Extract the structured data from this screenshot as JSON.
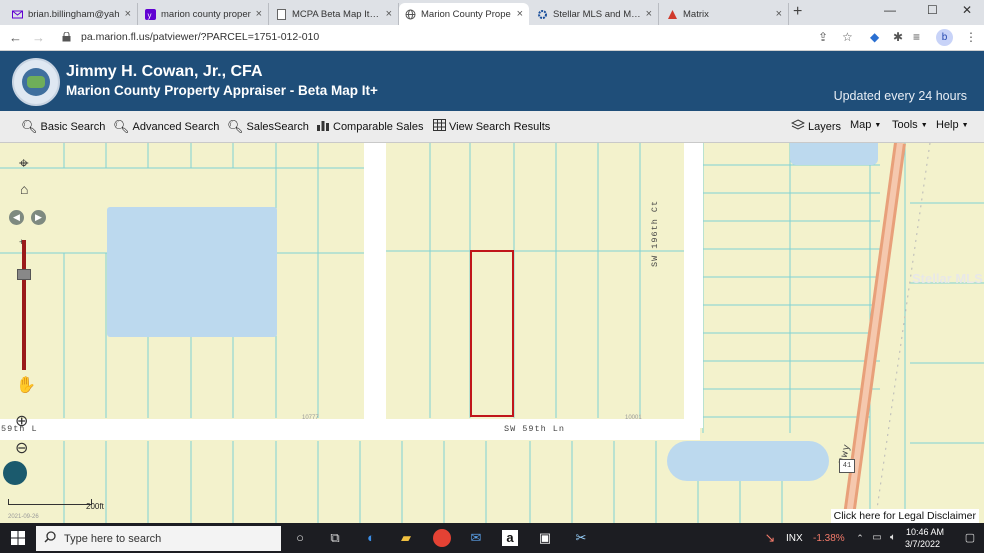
{
  "browser": {
    "tabs": [
      {
        "title": "brian.billingham@yah",
        "favicon": "mail-icon",
        "color": "#6001d2"
      },
      {
        "title": "marion county proper",
        "favicon": "yahoo-icon",
        "color": "#6001d2"
      },
      {
        "title": "MCPA Beta Map It+ A",
        "favicon": "document-icon",
        "color": "#555555"
      },
      {
        "title": "Marion County Prope",
        "favicon": "globe-icon",
        "color": "#555555",
        "active": true
      },
      {
        "title": "Stellar MLS and Matri",
        "favicon": "gear-icon",
        "color": "#1a4f9c"
      },
      {
        "title": "Matrix",
        "favicon": "matrix-icon",
        "color": "#d0392b"
      }
    ],
    "close_glyph": "×",
    "new_tab": "+",
    "window_controls": [
      "—",
      "☐",
      "✕"
    ],
    "url": "pa.marion.fl.us/patviewer/?PARCEL=1751-012-010",
    "profile_initial": "b"
  },
  "header": {
    "title": "Jimmy H. Cowan, Jr., CFA",
    "subtitle": "Marion County Property Appraiser - Beta Map It+",
    "updated": "Updated every 24 hours"
  },
  "toolbar": {
    "basic_search": "Basic Search",
    "advanced_search": "Advanced Search",
    "sales_search": "SalesSearch",
    "comparable_sales": "Comparable Sales",
    "view_results": "View Search Results",
    "layers": "Layers",
    "map": "Map",
    "tools": "Tools",
    "help": "Help"
  },
  "map": {
    "street_horizontal": "SW 59th Ln",
    "street_left_fragment": "59th L",
    "street_vertical": "SW 196th Ct",
    "highway": "Hwy",
    "highway_shield": "41",
    "parcel_number_left": "10777",
    "parcel_number_right": "10001",
    "watermark": "Stellar MLS",
    "scale": "200ft",
    "imagery_date": "2021-09-26",
    "disclaimer": "Click here for Legal Disclaimer"
  },
  "taskbar": {
    "search_placeholder": "Type here to search",
    "ticker": "INX",
    "ticker_change": "-1.38%",
    "time": "10:46 AM",
    "date": "3/7/2022"
  }
}
